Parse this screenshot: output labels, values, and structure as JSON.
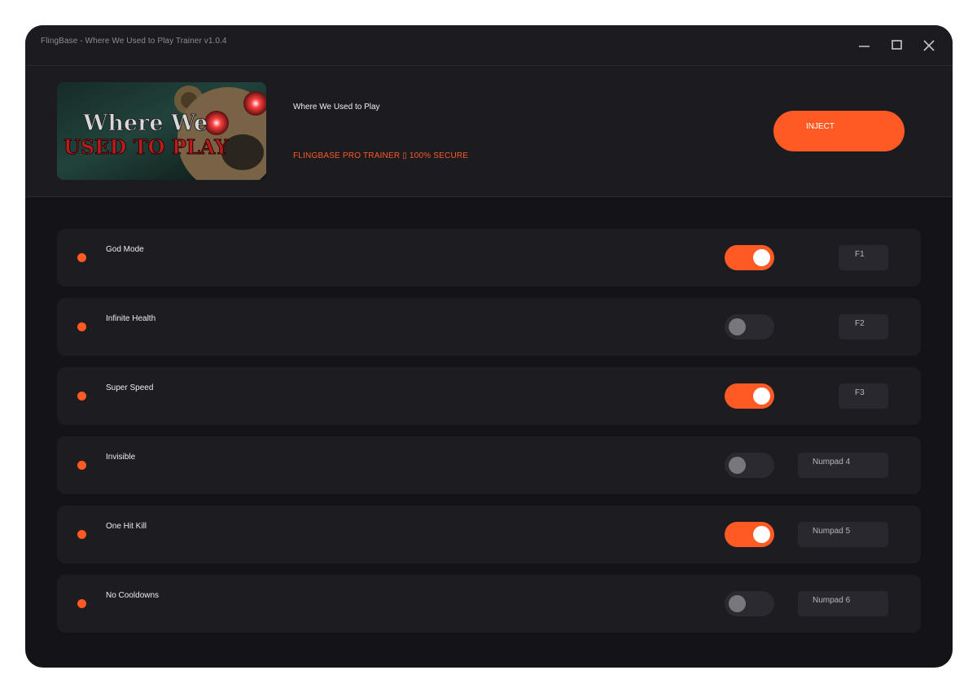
{
  "window": {
    "title": "FlingBase - Where We Used to Play Trainer v1.0.4"
  },
  "header": {
    "banner_line1": "Where We",
    "banner_line2": "USED TO PLAY",
    "game_title": "Where We Used to Play",
    "subtitle": "FLINGBASE PRO TRAINER ▯ 100% SECURE",
    "inject_label": "INJECT"
  },
  "colors": {
    "accent": "#ff5a24",
    "background": "#141418",
    "panel": "#1c1c21"
  },
  "cheats": [
    {
      "name": "God Mode",
      "enabled": true,
      "hotkey": "F1"
    },
    {
      "name": "Infinite Health",
      "enabled": false,
      "hotkey": "F2"
    },
    {
      "name": "Super Speed",
      "enabled": true,
      "hotkey": "F3"
    },
    {
      "name": "Invisible",
      "enabled": false,
      "hotkey": "Numpad 4"
    },
    {
      "name": "One Hit Kill",
      "enabled": true,
      "hotkey": "Numpad 5"
    },
    {
      "name": "No Cooldowns",
      "enabled": false,
      "hotkey": "Numpad 6"
    }
  ]
}
